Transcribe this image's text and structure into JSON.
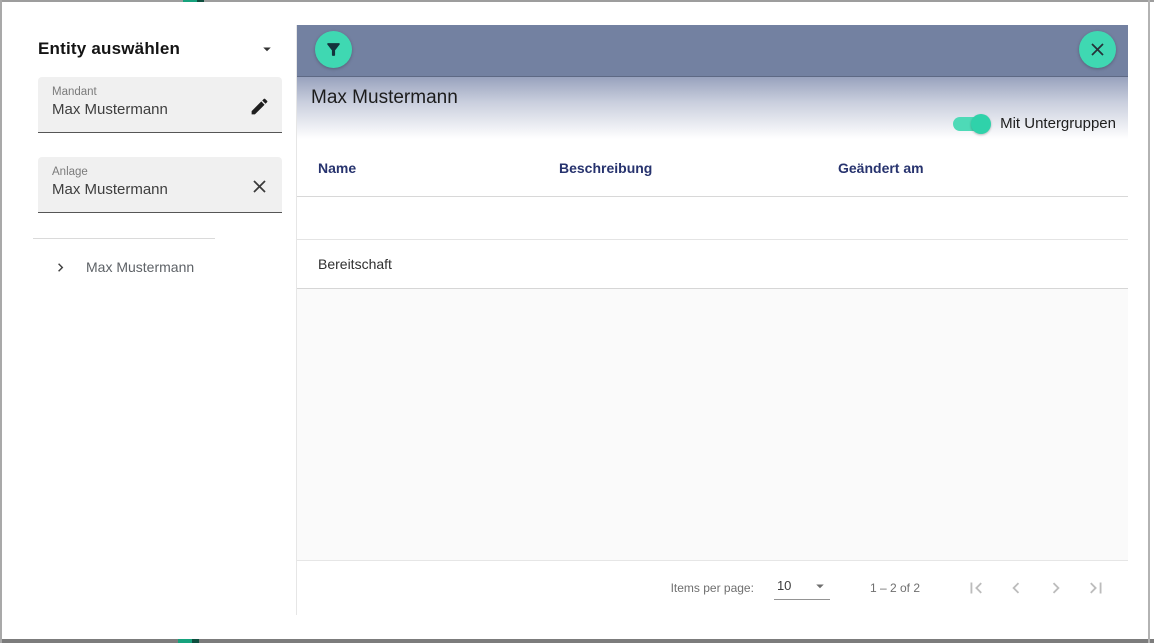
{
  "sidebar": {
    "title": "Entity auswählen",
    "mandant_field": {
      "label": "Mandant",
      "value": "Max Mustermann"
    },
    "anlage_field": {
      "label": "Anlage",
      "value": "Max Mustermann"
    },
    "tree_item": {
      "label": "Max Mustermann"
    }
  },
  "panel": {
    "title": "Max Mustermann",
    "toggle": {
      "label": "Mit Untergruppen",
      "state": "on"
    },
    "table": {
      "columns": [
        "Name",
        "Beschreibung",
        "Geändert am"
      ],
      "rows": [
        {
          "name": "",
          "redacted": true
        },
        {
          "name": "Bereitschaft",
          "redacted": false
        }
      ]
    },
    "paginator": {
      "items_per_page_label": "Items per page:",
      "page_size": "10",
      "range": "1 – 2 of 2"
    }
  },
  "colors": {
    "accent_teal": "#3fd8b2",
    "header_bar": "#7381a1",
    "table_header_text": "#27336e",
    "frame_accent": "#17a27d"
  }
}
